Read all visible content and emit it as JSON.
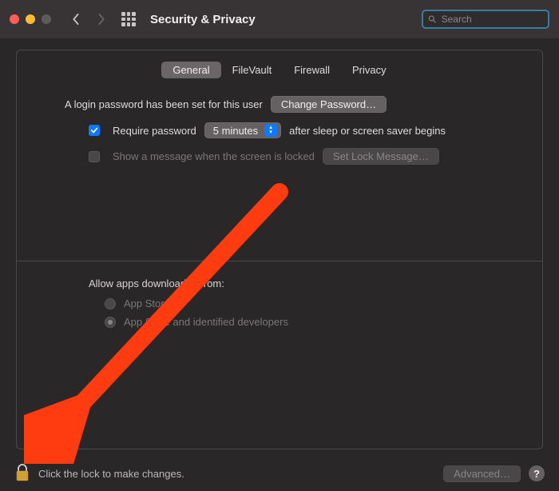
{
  "window": {
    "title": "Security & Privacy"
  },
  "search": {
    "placeholder": "Search"
  },
  "tabs": {
    "general": "General",
    "filevault": "FileVault",
    "firewall": "Firewall",
    "privacy": "Privacy",
    "active": "general"
  },
  "login": {
    "text": "A login password has been set for this user",
    "change_btn": "Change Password…"
  },
  "require_pw": {
    "label_left": "Require password",
    "delay_selected": "5 minutes",
    "label_right": "after sleep or screen saver begins",
    "checked": true
  },
  "lock_message": {
    "label": "Show a message when the screen is locked",
    "set_btn": "Set Lock Message…"
  },
  "allow_apps": {
    "heading": "Allow apps downloaded from:",
    "option1": "App Store",
    "option2": "App Store and identified developers",
    "selected": "option2"
  },
  "footer": {
    "lock_text": "Click the lock to make changes.",
    "advanced_btn": "Advanced…",
    "help": "?"
  },
  "colors": {
    "accent": "#0a7bff",
    "annotation": "#ff3b10"
  }
}
